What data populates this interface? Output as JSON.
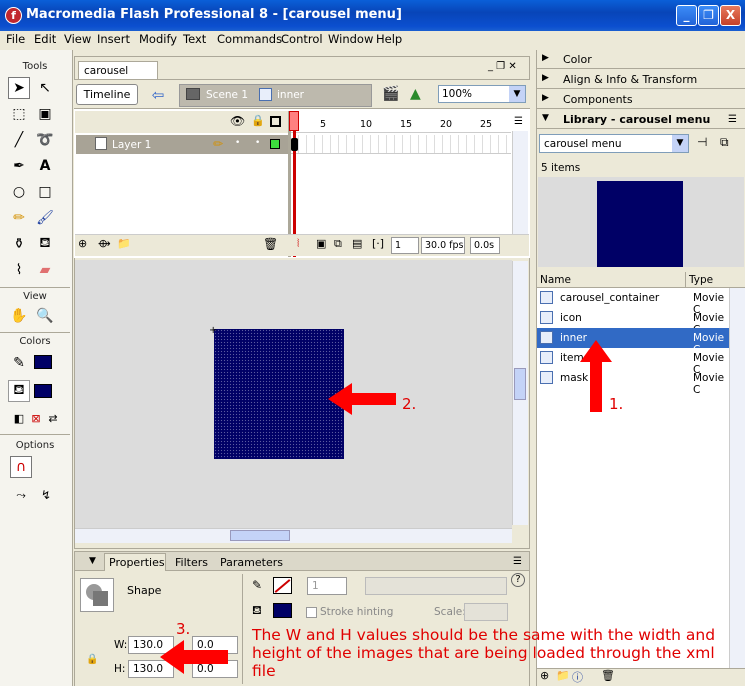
{
  "window": {
    "title": "Macromedia Flash Professional 8 - [carousel menu]",
    "app_icon_letter": "f",
    "controls": [
      "_",
      "❐",
      "X"
    ]
  },
  "menu": [
    "File",
    "Edit",
    "View",
    "Insert",
    "Modify",
    "Text",
    "Commands",
    "Control",
    "Window",
    "Help"
  ],
  "tools": {
    "header": "Tools",
    "view_header": "View",
    "colors_header": "Colors",
    "options_header": "Options"
  },
  "document": {
    "tab": "carousel menu",
    "timeline_button": "Timeline",
    "breadcrumb": [
      "Scene 1",
      "inner"
    ],
    "zoom": "100%"
  },
  "timeline": {
    "layer_name": "Layer 1",
    "frame_numbers": [
      "1",
      "5",
      "10",
      "15",
      "20",
      "25"
    ],
    "current_frame": "1",
    "fps": "30.0 fps",
    "elapsed": "0.0s"
  },
  "properties": {
    "tabs": [
      "Properties",
      "Filters",
      "Parameters"
    ],
    "type_label": "Shape",
    "stroke_size": "1",
    "stroke_hinting": "Stroke hinting",
    "scale_label": "Scale:",
    "w_label": "W:",
    "h_label": "H:",
    "w_value": "130.0",
    "h_value": "130.0",
    "x_value": "0.0",
    "y_value": "0.0"
  },
  "panels": {
    "color": "Color",
    "align": "Align & Info & Transform",
    "components": "Components",
    "library": "Library - carousel menu"
  },
  "library": {
    "selected_doc": "carousel menu",
    "count": "5 items",
    "col_name": "Name",
    "col_type": "Type",
    "items": [
      {
        "name": "carousel_container",
        "type": "Movie C"
      },
      {
        "name": "icon",
        "type": "Movie C"
      },
      {
        "name": "inner",
        "type": "Movie C"
      },
      {
        "name": "item",
        "type": "Movie C"
      },
      {
        "name": "mask",
        "type": "Movie C"
      }
    ]
  },
  "annotations": {
    "label_1": "1.",
    "label_2": "2.",
    "label_3": "3.",
    "note": "The W and H values should be the same with the width and height of the images that are being loaded through the xml file"
  },
  "colors": {
    "accent_red": "#e00000",
    "shape_fill": "#000066",
    "selection": "#316ac5"
  }
}
